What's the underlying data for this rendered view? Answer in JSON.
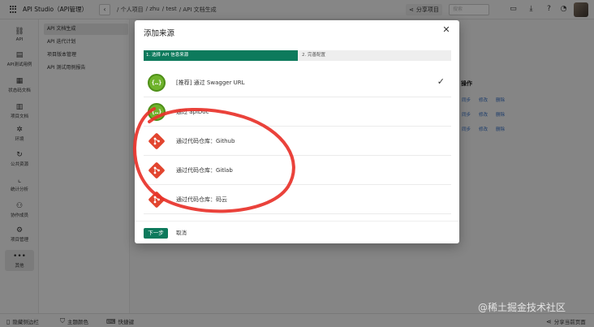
{
  "topbar": {
    "app_title": "API Studio（API管理）",
    "breadcrumb": [
      "/ 个人项目",
      "/ zhu",
      "/ test",
      "/ API 文档生成"
    ],
    "share_label": "分享项目",
    "search_placeholder": "搜索"
  },
  "sidebar": {
    "items": [
      {
        "label": "API",
        "icon": "link-icon"
      },
      {
        "label": "API测试用例",
        "icon": "clipboard-icon"
      },
      {
        "label": "状态码文档",
        "icon": "document-icon"
      },
      {
        "label": "项目文档",
        "icon": "book-icon"
      },
      {
        "label": "环境",
        "icon": "gear-nodes-icon"
      },
      {
        "label": "公共资源",
        "icon": "refresh-icon"
      },
      {
        "label": "统计分析",
        "icon": "chart-icon"
      },
      {
        "label": "协作成员",
        "icon": "users-icon"
      },
      {
        "label": "项目管理",
        "icon": "settings-icon"
      },
      {
        "label": "其他",
        "icon": "more-icon"
      }
    ]
  },
  "subnav": {
    "items": [
      {
        "label": "API 文档生成"
      },
      {
        "label": "API 迭代计划"
      },
      {
        "label": "项目版本管理"
      },
      {
        "label": "API 测试用例报告"
      }
    ]
  },
  "background_table": {
    "header": "操作",
    "rows": [
      [
        "同步",
        "修改",
        "删除"
      ],
      [
        "同步",
        "修改",
        "删除"
      ],
      [
        "同步",
        "修改",
        "删除"
      ]
    ]
  },
  "statusbar": {
    "hide_sidebar": "隐藏侧边栏",
    "theme_color": "主题颜色",
    "shortcuts": "快捷键",
    "share_page": "分享当前页面"
  },
  "modal": {
    "title": "添加来源",
    "steps": [
      "1. 选择 API 信息来源",
      "2. 完善配置"
    ],
    "sources": [
      {
        "label": "[推荐] 通过 Swagger URL",
        "logo": "swagger-icon",
        "selected": true
      },
      {
        "label": "通过 apiDoc",
        "logo": "swagger-icon",
        "selected": false
      },
      {
        "label": "通过代码仓库：Github",
        "logo": "git-icon",
        "selected": false
      },
      {
        "label": "通过代码仓库：Gitlab",
        "logo": "git-icon",
        "selected": false
      },
      {
        "label": "通过代码仓库：码云",
        "logo": "git-icon",
        "selected": false
      }
    ],
    "next_label": "下一步",
    "cancel_label": "取消"
  },
  "watermark": "@稀土掘金技术社区",
  "colors": {
    "accent": "#0d7a5c",
    "swagger_green": "#6fb32c",
    "git_red": "#e2452f",
    "annotation_red": "#e8322a",
    "link_blue": "#2f6bc2"
  }
}
